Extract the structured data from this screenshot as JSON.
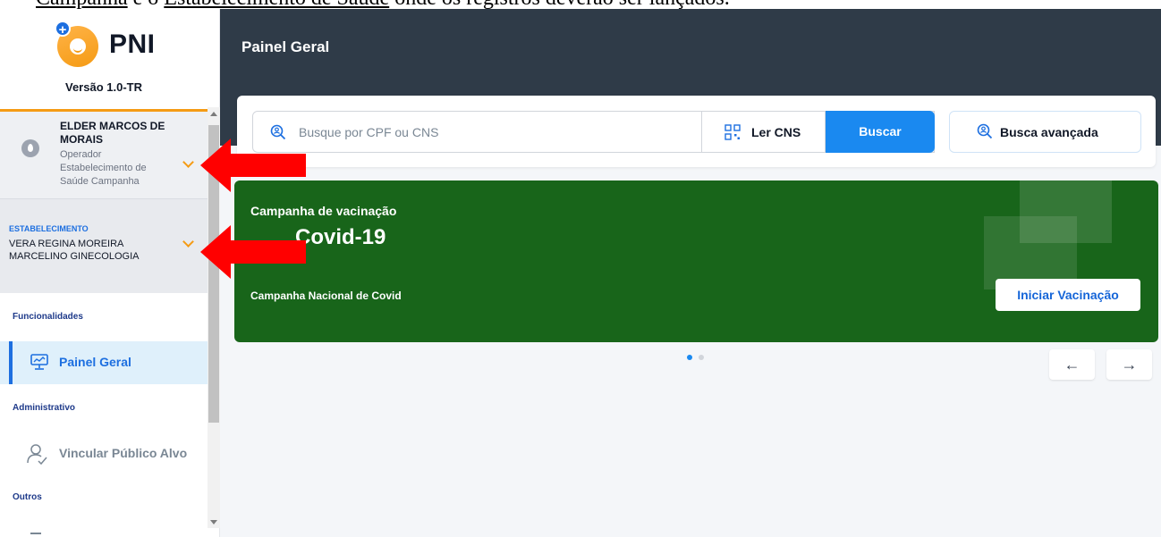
{
  "doc_caption": {
    "part1": "Campanha",
    "part2": " e o ",
    "part3": "Estabelecimento de Saúde",
    "part4": " onde os registros deverão ser lançados."
  },
  "sidebar": {
    "logo_text": "PNI",
    "version": "Versão 1.0-TR",
    "user": {
      "name": "ELDER MARCOS DE MORAIS",
      "role": "Operador Estabelecimento de Saúde Campanha"
    },
    "establishment": {
      "label": "ESTABELECIMENTO",
      "name": "VERA REGINA MOREIRA MARCELINO GINECOLOGIA"
    },
    "sections": {
      "functionalities": "Funcionalidades",
      "administrative": "Administrativo",
      "others": "Outros"
    },
    "items": {
      "painel_geral": "Painel Geral",
      "vincular": "Vincular Público Alvo"
    }
  },
  "header": {
    "title": "Painel Geral"
  },
  "search": {
    "placeholder": "Busque por CPF ou CNS",
    "ler_cns": "Ler CNS",
    "buscar": "Buscar",
    "advanced": "Busca avançada"
  },
  "campaign": {
    "kicker": "Campanha de vacinação",
    "title": "Covid-19",
    "subtitle": "Campanha Nacional de Covid",
    "start_button": "Iniciar Vacinação"
  },
  "carousel": {
    "prev": "←",
    "next": "→",
    "active_index": 0,
    "count": 2
  },
  "colors": {
    "accent": "#1a89f0",
    "brand_orange": "#f59b14",
    "header": "#2f3b48",
    "campaign": "#18651a",
    "annotation": "#ff0000"
  }
}
